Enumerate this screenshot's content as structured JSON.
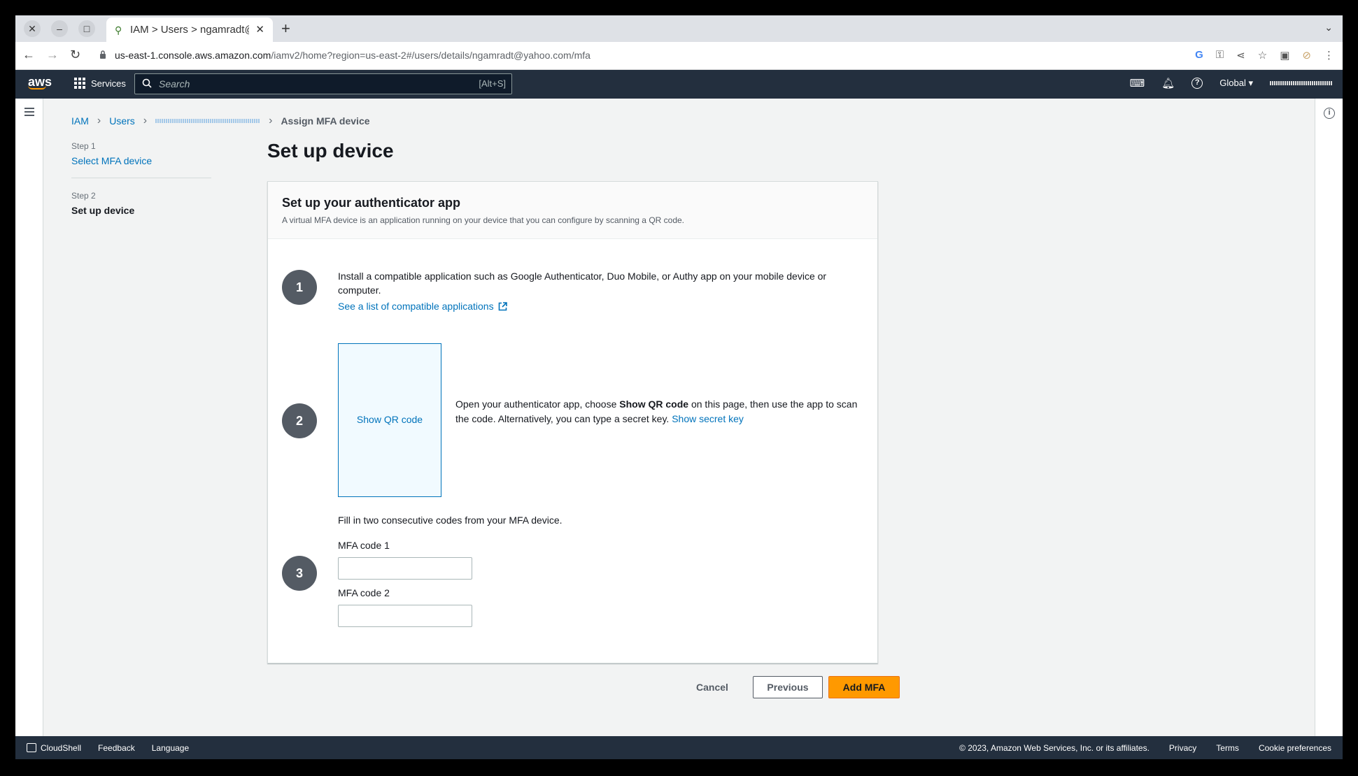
{
  "browser": {
    "tab_title": "IAM > Users > ngamradt@",
    "url_host": "us-east-1.console.aws.amazon.com",
    "url_path": "/iamv2/home?region=us-east-2#/users/details/ngamradt@yahoo.com/mfa"
  },
  "aws_nav": {
    "logo": "aws",
    "services_label": "Services",
    "search_placeholder": "Search",
    "search_shortcut": "[Alt+S]",
    "region_label": "Global"
  },
  "breadcrumb": {
    "items": [
      "IAM",
      "Users"
    ],
    "current": "Assign MFA device"
  },
  "steps": {
    "step1_label": "Step 1",
    "step1_title": "Select MFA device",
    "step2_label": "Step 2",
    "step2_title": "Set up device"
  },
  "page_title": "Set up device",
  "panel": {
    "title": "Set up your authenticator app",
    "subtitle": "A virtual MFA device is an application running on your device that you can configure by scanning a QR code.",
    "step1_number": "1",
    "step1_text": "Install a compatible application such as Google Authenticator, Duo Mobile, or Authy app on your mobile device or computer.",
    "step1_link": "See a list of compatible applications",
    "step2_number": "2",
    "qr_button": "Show QR code",
    "step2_text_a": "Open your authenticator app, choose ",
    "step2_text_bold": "Show QR code",
    "step2_text_b": " on this page, then use the app to scan the code. Alternatively, you can type a secret key. ",
    "step2_link": "Show secret key",
    "step3_number": "3",
    "step3_text": "Fill in two consecutive codes from your MFA device.",
    "mfa1_label": "MFA code 1",
    "mfa1_value": "",
    "mfa2_label": "MFA code 2",
    "mfa2_value": ""
  },
  "actions": {
    "cancel": "Cancel",
    "previous": "Previous",
    "add": "Add MFA"
  },
  "footer": {
    "cloudshell": "CloudShell",
    "feedback": "Feedback",
    "language": "Language",
    "copyright": "© 2023, Amazon Web Services, Inc. or its affiliates.",
    "privacy": "Privacy",
    "terms": "Terms",
    "cookies": "Cookie preferences"
  },
  "colors": {
    "aws_nav": "#232f3e",
    "link": "#0073bb",
    "primary_button": "#ff9900"
  }
}
